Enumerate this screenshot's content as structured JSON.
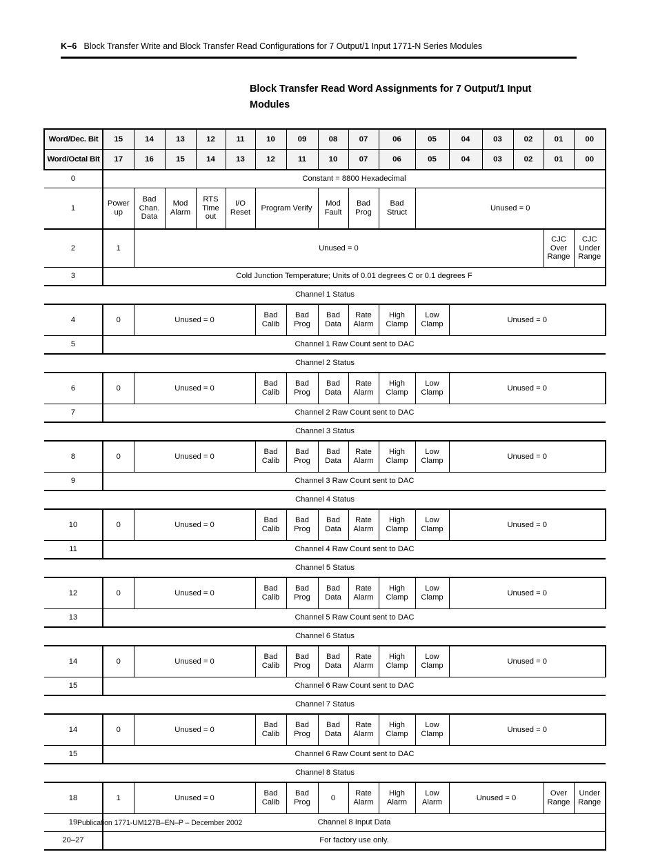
{
  "running_header": {
    "page_number": "K–6",
    "text": "Block Transfer Write and Block Transfer Read Configurations for 7 Output/1 Input 1771-N Series Modules"
  },
  "section_title": "Block Transfer Read Word Assignments for 7 Output/1 Input Modules",
  "table": {
    "header_rows": [
      {
        "label": "Word/Dec. Bit",
        "bits": [
          "15",
          "14",
          "13",
          "12",
          "11",
          "10",
          "09",
          "08",
          "07",
          "06",
          "05",
          "04",
          "03",
          "02",
          "01",
          "00"
        ]
      },
      {
        "label": "Word/Octal Bit",
        "bits": [
          "17",
          "16",
          "15",
          "14",
          "13",
          "12",
          "11",
          "10",
          "07",
          "06",
          "05",
          "04",
          "03",
          "02",
          "01",
          "00"
        ]
      }
    ],
    "word0": {
      "word": "0",
      "text": "Constant = 8800 Hexadecimal"
    },
    "word1": {
      "word": "1",
      "cells": [
        "Power up",
        "Bad Chan. Data",
        "Mod Alarm",
        "RTS Time out",
        "I/O Reset",
        "Program Verify",
        "Mod Fault",
        "Bad Prog",
        "Bad Struct",
        "Unused = 0"
      ]
    },
    "word2": {
      "word": "2",
      "bit15": "1",
      "unused": "Unused = 0",
      "cjc_over": "CJC Over Range",
      "cjc_under": "CJC Under Range"
    },
    "word3": {
      "word": "3",
      "text": "Cold Junction Temperature; Units of 0.01 degrees C or 0.1 degrees F"
    },
    "channels": [
      {
        "status_label": "Channel 1 Status",
        "status_word": "4",
        "bit15": "0",
        "unused_left": "Unused = 0",
        "flags": [
          "Bad Calib",
          "Bad Prog",
          "Bad Data",
          "Rate Alarm",
          "High Clamp",
          "Low Clamp"
        ],
        "unused_right": "Unused = 0",
        "data_word": "5",
        "data_text": "Channel 1 Raw Count sent to DAC"
      },
      {
        "status_label": "Channel 2 Status",
        "status_word": "6",
        "bit15": "0",
        "unused_left": "Unused = 0",
        "flags": [
          "Bad Calib",
          "Bad Prog",
          "Bad Data",
          "Rate Alarm",
          "High Clamp",
          "Low Clamp"
        ],
        "unused_right": "Unused = 0",
        "data_word": "7",
        "data_text": "Channel 2 Raw Count sent to DAC"
      },
      {
        "status_label": "Channel 3 Status",
        "status_word": "8",
        "bit15": "0",
        "unused_left": "Unused = 0",
        "flags": [
          "Bad Calib",
          "Bad Prog",
          "Bad Data",
          "Rate Alarm",
          "High Clamp",
          "Low Clamp"
        ],
        "unused_right": "Unused = 0",
        "data_word": "9",
        "data_text": "Channel 3 Raw Count sent to DAC"
      },
      {
        "status_label": "Channel 4 Status",
        "status_word": "10",
        "bit15": "0",
        "unused_left": "Unused = 0",
        "flags": [
          "Bad Calib",
          "Bad Prog",
          "Bad Data",
          "Rate Alarm",
          "High Clamp",
          "Low Clamp"
        ],
        "unused_right": "Unused = 0",
        "data_word": "11",
        "data_text": "Channel 4 Raw Count sent to DAC"
      },
      {
        "status_label": "Channel 5 Status",
        "status_word": "12",
        "bit15": "0",
        "unused_left": "Unused = 0",
        "flags": [
          "Bad Calib",
          "Bad Prog",
          "Bad Data",
          "Rate Alarm",
          "High Clamp",
          "Low Clamp"
        ],
        "unused_right": "Unused = 0",
        "data_word": "13",
        "data_text": "Channel 5 Raw Count sent to DAC"
      },
      {
        "status_label": "Channel 6 Status",
        "status_word": "14",
        "bit15": "0",
        "unused_left": "Unused = 0",
        "flags": [
          "Bad Calib",
          "Bad Prog",
          "Bad Data",
          "Rate Alarm",
          "High Clamp",
          "Low Clamp"
        ],
        "unused_right": "Unused = 0",
        "data_word": "15",
        "data_text": "Channel 6 Raw Count sent to DAC"
      },
      {
        "status_label": "Channel 7 Status",
        "status_word": "14",
        "bit15": "0",
        "unused_left": "Unused = 0",
        "flags": [
          "Bad Calib",
          "Bad Prog",
          "Bad Data",
          "Rate Alarm",
          "High Clamp",
          "Low Clamp"
        ],
        "unused_right": "Unused = 0",
        "data_word": "15",
        "data_text": "Channel 6 Raw Count sent to DAC"
      }
    ],
    "channel8": {
      "status_label": "Channel 8 Status",
      "status_word": "18",
      "bit15": "1",
      "unused_left": "Unused = 0",
      "flags": [
        "Bad Calib",
        "Bad Prog",
        "0",
        "Rate Alarm",
        "High Alarm",
        "Low Alarm"
      ],
      "unused_right": "Unused = 0",
      "over_range": "Over Range",
      "under_range": "Under Range",
      "data_word": "19",
      "data_text": "Channel 8 Input Data"
    },
    "factory": {
      "word": "20–27",
      "text": "For factory use only."
    }
  },
  "footer": "Publication 1771-UM127B–EN–P – December 2002"
}
